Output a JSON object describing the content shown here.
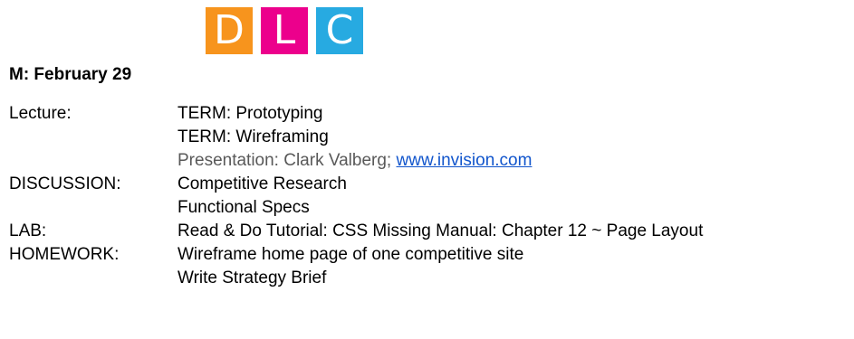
{
  "header": {
    "date": "M: February 29",
    "logo": {
      "letters": [
        "D",
        "L",
        "C"
      ],
      "colors": [
        "#f7941d",
        "#ec008c",
        "#27aae1"
      ]
    }
  },
  "schedule": {
    "lecture": {
      "label": "Lecture:",
      "items": [
        "TERM: Prototyping",
        "TERM: Wireframing"
      ],
      "presentation_text": "Presentation: Clark Valberg; ",
      "presentation_link": "www.invision.com"
    },
    "discussion": {
      "label": "DISCUSSION:",
      "items": [
        "Competitive Research",
        "Functional Specs"
      ]
    },
    "lab": {
      "label": "LAB:",
      "items": [
        "Read & Do Tutorial: CSS Missing Manual: Chapter 12 ~ Page Layout"
      ]
    },
    "homework": {
      "label": "HOMEWORK:",
      "items": [
        "Wireframe home page of one competitive site",
        "Write Strategy Brief"
      ]
    }
  },
  "colors": {
    "text": "#000000",
    "muted_text": "#595959",
    "link": "#1155cc"
  }
}
